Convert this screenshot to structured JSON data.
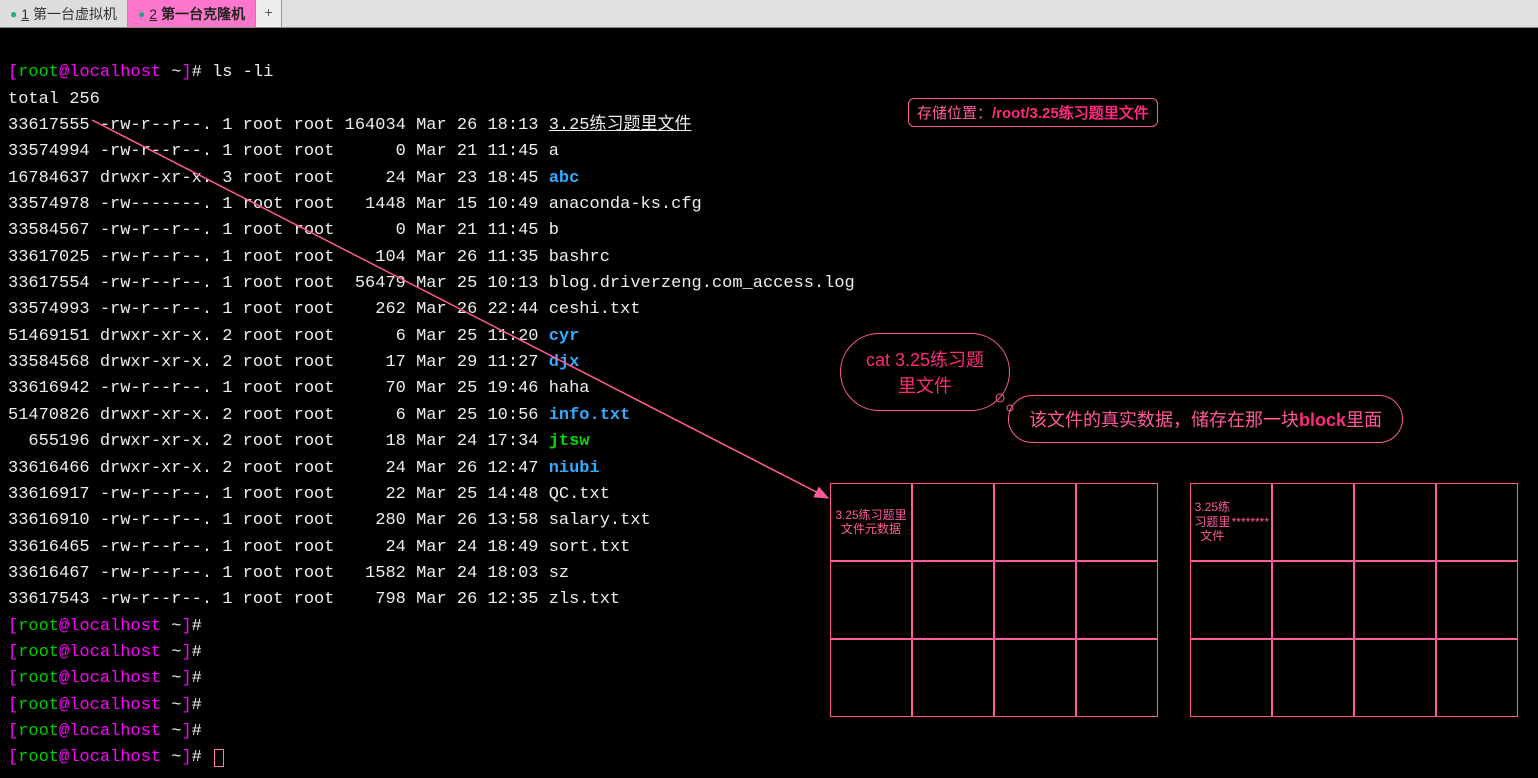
{
  "tabs": [
    {
      "num": "1",
      "label": "第一台虚拟机"
    },
    {
      "num": "2",
      "label": "第一台克隆机"
    }
  ],
  "newtab": "+",
  "prompt": {
    "user": "root",
    "host": "localhost",
    "path": "~",
    "hash": "#"
  },
  "cmd": "ls -li",
  "total": "total 256",
  "files": [
    {
      "inode": "33617555",
      "perm": "-rw-r--r--.",
      "ln": "1",
      "own": "root",
      "grp": "root",
      "size": "164034",
      "date": "Mar 26 18:13",
      "name": "3.25练习题里文件",
      "style": "hl-file"
    },
    {
      "inode": "33574994",
      "perm": "-rw-r--r--.",
      "ln": "1",
      "own": "root",
      "grp": "root",
      "size": "     0",
      "date": "Mar 21 11:45",
      "name": "a",
      "style": ""
    },
    {
      "inode": "16784637",
      "perm": "drwxr-xr-x.",
      "ln": "3",
      "own": "root",
      "grp": "root",
      "size": "    24",
      "date": "Mar 23 18:45",
      "name": "abc",
      "style": "dir"
    },
    {
      "inode": "33574978",
      "perm": "-rw-------.",
      "ln": "1",
      "own": "root",
      "grp": "root",
      "size": "  1448",
      "date": "Mar 15 10:49",
      "name": "anaconda-ks.cfg",
      "style": ""
    },
    {
      "inode": "33584567",
      "perm": "-rw-r--r--.",
      "ln": "1",
      "own": "root",
      "grp": "root",
      "size": "     0",
      "date": "Mar 21 11:45",
      "name": "b",
      "style": ""
    },
    {
      "inode": "33617025",
      "perm": "-rw-r--r--.",
      "ln": "1",
      "own": "root",
      "grp": "root",
      "size": "   104",
      "date": "Mar 26 11:35",
      "name": "bashrc",
      "style": ""
    },
    {
      "inode": "33617554",
      "perm": "-rw-r--r--.",
      "ln": "1",
      "own": "root",
      "grp": "root",
      "size": " 56479",
      "date": "Mar 25 10:13",
      "name": "blog.driverzeng.com_access.log",
      "style": ""
    },
    {
      "inode": "33574993",
      "perm": "-rw-r--r--.",
      "ln": "1",
      "own": "root",
      "grp": "root",
      "size": "   262",
      "date": "Mar 26 22:44",
      "name": "ceshi.txt",
      "style": ""
    },
    {
      "inode": "51469151",
      "perm": "drwxr-xr-x.",
      "ln": "2",
      "own": "root",
      "grp": "root",
      "size": "     6",
      "date": "Mar 25 11:20",
      "name": "cyr",
      "style": "dir"
    },
    {
      "inode": "33584568",
      "perm": "drwxr-xr-x.",
      "ln": "2",
      "own": "root",
      "grp": "root",
      "size": "    17",
      "date": "Mar 29 11:27",
      "name": "djx",
      "style": "dir"
    },
    {
      "inode": "33616942",
      "perm": "-rw-r--r--.",
      "ln": "1",
      "own": "root",
      "grp": "root",
      "size": "    70",
      "date": "Mar 25 19:46",
      "name": "haha",
      "style": ""
    },
    {
      "inode": "51470826",
      "perm": "drwxr-xr-x.",
      "ln": "2",
      "own": "root",
      "grp": "root",
      "size": "     6",
      "date": "Mar 25 10:56",
      "name": "info.txt",
      "style": "dir"
    },
    {
      "inode": "  655196",
      "perm": "drwxr-xr-x.",
      "ln": "2",
      "own": "root",
      "grp": "root",
      "size": "    18",
      "date": "Mar 24 17:34",
      "name": "jtsw",
      "style": "exe"
    },
    {
      "inode": "33616466",
      "perm": "drwxr-xr-x.",
      "ln": "2",
      "own": "root",
      "grp": "root",
      "size": "    24",
      "date": "Mar 26 12:47",
      "name": "niubi",
      "style": "dir"
    },
    {
      "inode": "33616917",
      "perm": "-rw-r--r--.",
      "ln": "1",
      "own": "root",
      "grp": "root",
      "size": "    22",
      "date": "Mar 25 14:48",
      "name": "QC.txt",
      "style": ""
    },
    {
      "inode": "33616910",
      "perm": "-rw-r--r--.",
      "ln": "1",
      "own": "root",
      "grp": "root",
      "size": "   280",
      "date": "Mar 26 13:58",
      "name": "salary.txt",
      "style": ""
    },
    {
      "inode": "33616465",
      "perm": "-rw-r--r--.",
      "ln": "1",
      "own": "root",
      "grp": "root",
      "size": "    24",
      "date": "Mar 24 18:49",
      "name": "sort.txt",
      "style": ""
    },
    {
      "inode": "33616467",
      "perm": "-rw-r--r--.",
      "ln": "1",
      "own": "root",
      "grp": "root",
      "size": "  1582",
      "date": "Mar 24 18:03",
      "name": "sz",
      "style": ""
    },
    {
      "inode": "33617543",
      "perm": "-rw-r--r--.",
      "ln": "1",
      "own": "root",
      "grp": "root",
      "size": "   798",
      "date": "Mar 26 12:35",
      "name": "zls.txt",
      "style": ""
    }
  ],
  "annot": {
    "storage_label": "存储位置：",
    "storage_path": "/root/3.25练习题里文件",
    "cat_cmd": "cat  3.25练习题里文件",
    "block_text_pre": "该文件的真实数据，储存在那一块",
    "block_text_bold": "block",
    "block_text_post": "里面",
    "grid1_label": "3.25练习题里文件元数据",
    "grid2_label_l1": "3.25练习题里文件",
    "grid2_label_l2": "********"
  }
}
